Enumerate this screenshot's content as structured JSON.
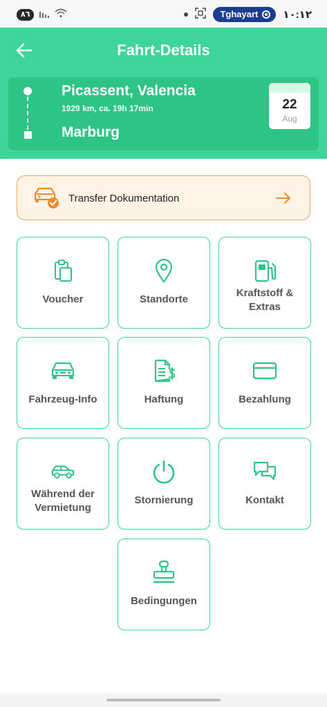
{
  "status_bar": {
    "battery": "٨٦",
    "carrier_pill": "Tghayart",
    "time": "١٠:١٢"
  },
  "header": {
    "title": "Fahrt-Details",
    "background": "#3dd598"
  },
  "route": {
    "from": "Picassent, Valencia",
    "meta": "1929 km, ca. 19h 17min",
    "to": "Marburg",
    "date_day": "22",
    "date_month": "Aug"
  },
  "transfer": {
    "label": "Transfer Dokumentation",
    "accent": "#f0a566"
  },
  "tiles": [
    {
      "label": "Voucher",
      "icon": "clipboard-icon"
    },
    {
      "label": "Standorte",
      "icon": "map-pin-icon"
    },
    {
      "label": "Kraftstoff & Extras",
      "icon": "fuel-pump-icon"
    },
    {
      "label": "Fahrzeug-Info",
      "icon": "car-front-icon"
    },
    {
      "label": "Haftung",
      "icon": "invoice-dollar-icon"
    },
    {
      "label": "Bezahlung",
      "icon": "credit-card-icon"
    },
    {
      "label": "Während der Vermietung",
      "icon": "car-side-icon"
    },
    {
      "label": "Stornierung",
      "icon": "power-icon"
    },
    {
      "label": "Kontakt",
      "icon": "chat-bubbles-icon"
    },
    {
      "label": "Bedingungen",
      "icon": "stamp-icon"
    }
  ],
  "colors": {
    "accent_green": "#3dd598",
    "card_green": "#2ec486",
    "tile_text": "#555555"
  }
}
